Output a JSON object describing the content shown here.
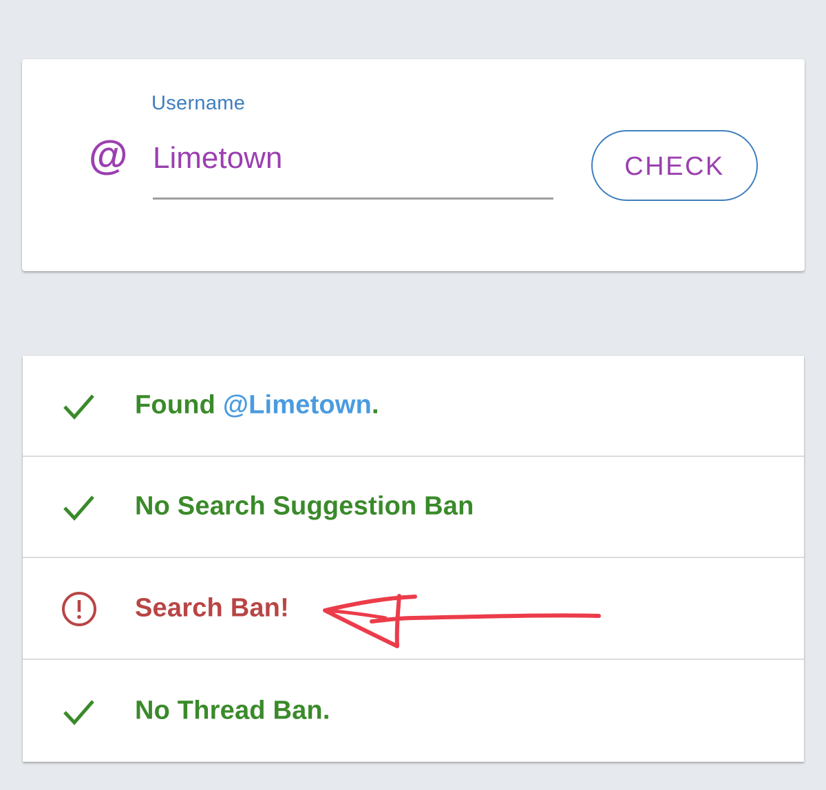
{
  "form": {
    "label": "Username",
    "prefix_icon": "at-icon",
    "prefix_symbol": "@",
    "value": "Limetown",
    "check_button_label": "CHECK"
  },
  "results": [
    {
      "status": "ok",
      "icon": "checkmark-icon",
      "text_prefix": "Found ",
      "mention": "@Limetown",
      "text_suffix": "."
    },
    {
      "status": "ok",
      "icon": "checkmark-icon",
      "text": "No Search Suggestion Ban"
    },
    {
      "status": "banned",
      "icon": "alert-circle-icon",
      "text": "Search Ban!"
    },
    {
      "status": "ok",
      "icon": "checkmark-icon",
      "text": "No Thread Ban."
    }
  ],
  "colors": {
    "background": "#e6e9ed",
    "accent_purple": "#9b3fb0",
    "accent_blue": "#3f7ec0",
    "ok_green": "#3a8a2a",
    "ban_red": "#b84545",
    "mention_blue": "#4a9be0",
    "annotation_red": "#ec3c4a"
  }
}
